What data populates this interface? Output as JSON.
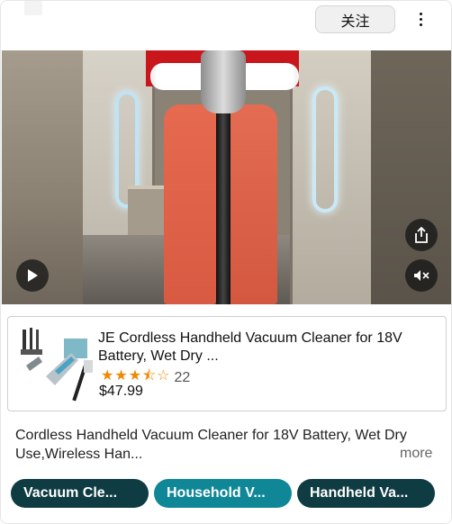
{
  "header": {
    "follow_label": "关注"
  },
  "video": {
    "controls": {
      "play_icon": "play-icon",
      "share_icon": "share-icon",
      "mute_icon": "muted-speaker-icon"
    }
  },
  "product": {
    "title": "JE Cordless Handheld Vacuum Cleaner for 18V Battery, Wet Dry ...",
    "rating_stars": 3.5,
    "rating_count": "22",
    "price": "$47.99",
    "star_color": "#f08804"
  },
  "description": {
    "text": "Cordless Handheld Vacuum Cleaner for 18V Battery, Wet Dry Use,Wireless Han...",
    "more_label": "more"
  },
  "tags": [
    {
      "label": "Vacuum Cle...",
      "color": "#0f3b42"
    },
    {
      "label": "Household V...",
      "color": "#0f8797"
    },
    {
      "label": "Handheld Va...",
      "color": "#0f3b42"
    }
  ]
}
